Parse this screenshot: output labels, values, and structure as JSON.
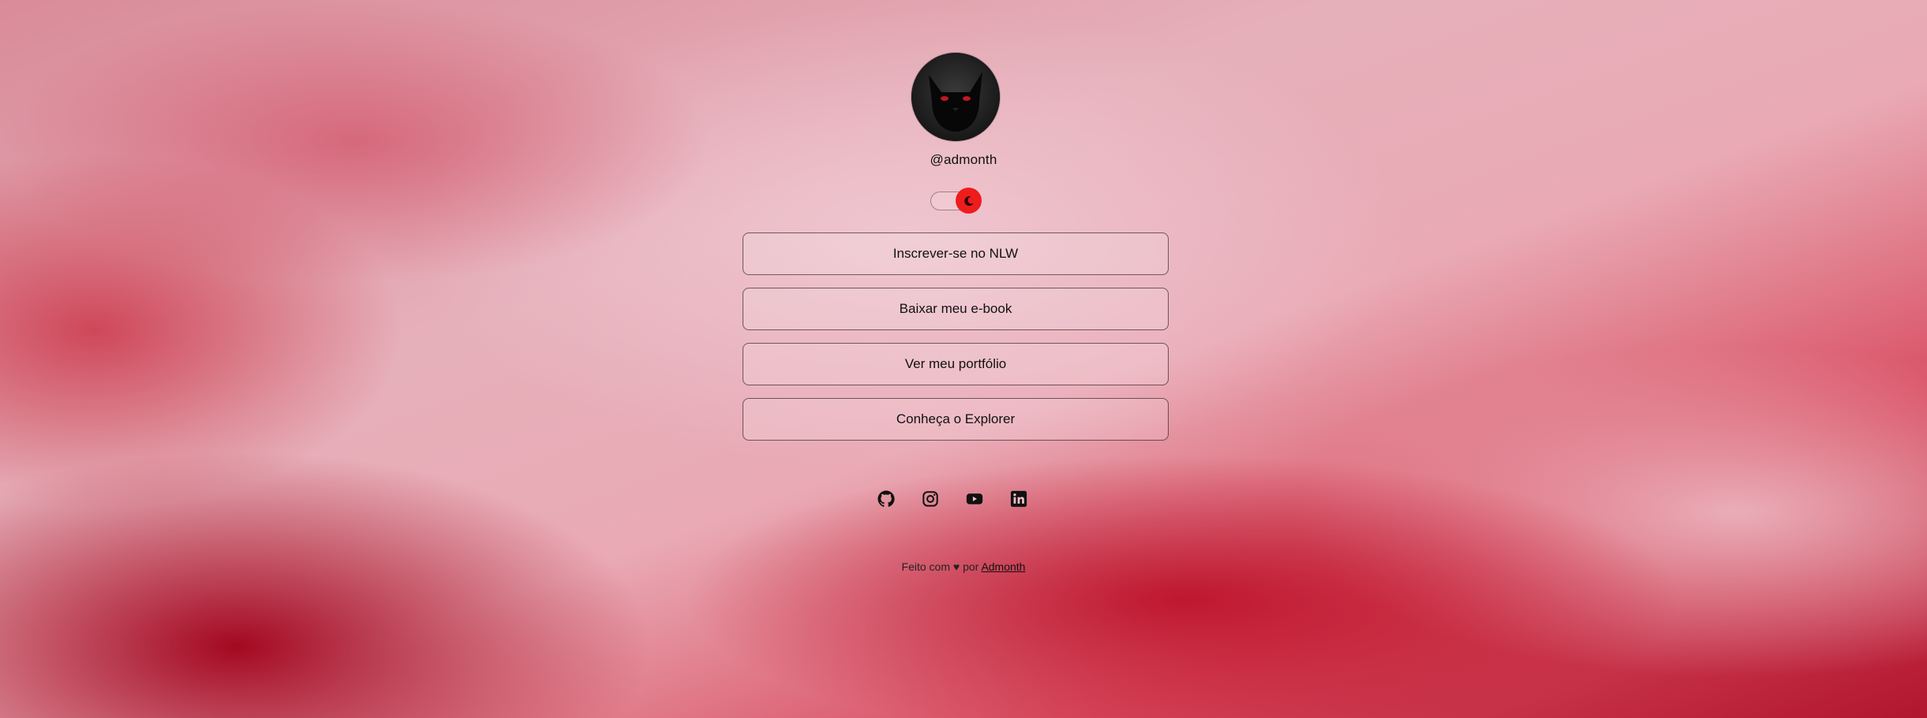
{
  "profile": {
    "handle": "@admonth"
  },
  "theme_toggle": {
    "state": "on",
    "accent": "#ee1c1c",
    "icon": "moon-icon"
  },
  "links": [
    {
      "label": "Inscrever-se no NLW"
    },
    {
      "label": "Baixar meu e-book"
    },
    {
      "label": "Ver meu portfólio"
    },
    {
      "label": "Conheça o Explorer"
    }
  ],
  "social": [
    {
      "icon": "github-icon"
    },
    {
      "icon": "instagram-icon"
    },
    {
      "icon": "youtube-icon"
    },
    {
      "icon": "linkedin-icon"
    }
  ],
  "footer": {
    "prefix": "Feito com",
    "heart": "♥",
    "middle": "por",
    "author": "Admonth"
  }
}
